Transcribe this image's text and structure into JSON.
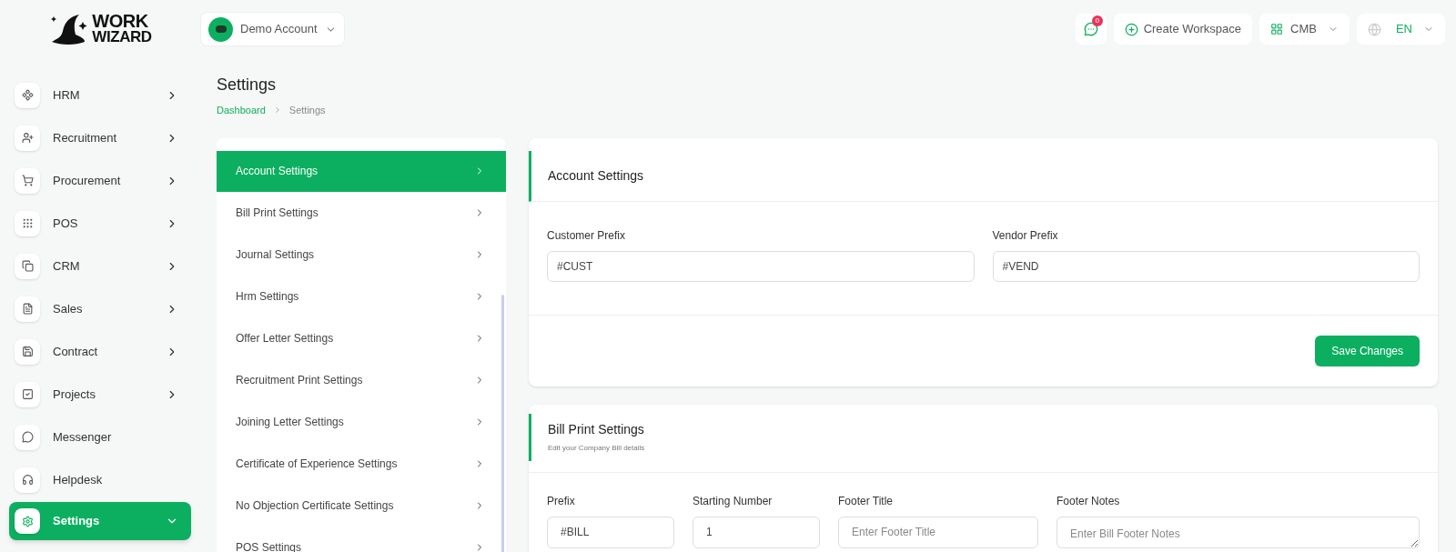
{
  "logo": {
    "line1": "WORK",
    "line2": "WIZARD"
  },
  "account_switcher": {
    "label": "Demo Account"
  },
  "header": {
    "notifications_badge": "0",
    "create_workspace": "Create Workspace",
    "workspace": "CMB",
    "language": "EN"
  },
  "sidebar": {
    "items": [
      {
        "label": "HRM",
        "kind": "submenu",
        "selected": false
      },
      {
        "label": "Recruitment",
        "kind": "submenu",
        "selected": false
      },
      {
        "label": "Procurement",
        "kind": "submenu",
        "selected": false
      },
      {
        "label": "POS",
        "kind": "submenu",
        "selected": false
      },
      {
        "label": "CRM",
        "kind": "submenu",
        "selected": false
      },
      {
        "label": "Sales",
        "kind": "submenu",
        "selected": false
      },
      {
        "label": "Contract",
        "kind": "submenu",
        "selected": false
      },
      {
        "label": "Projects",
        "kind": "submenu",
        "selected": false
      },
      {
        "label": "Messenger",
        "kind": "link",
        "selected": false
      },
      {
        "label": "Helpdesk",
        "kind": "link",
        "selected": false
      },
      {
        "label": "Settings",
        "kind": "submenu",
        "selected": true
      }
    ]
  },
  "page": {
    "title": "Settings",
    "breadcrumb": [
      "Dashboard",
      "Settings"
    ]
  },
  "settings_menu": [
    {
      "label": "Account Settings",
      "selected": true
    },
    {
      "label": "Bill Print Settings",
      "selected": false
    },
    {
      "label": "Journal Settings",
      "selected": false
    },
    {
      "label": "Hrm Settings",
      "selected": false
    },
    {
      "label": "Offer Letter Settings",
      "selected": false
    },
    {
      "label": "Recruitment Print Settings",
      "selected": false
    },
    {
      "label": "Joining Letter Settings",
      "selected": false
    },
    {
      "label": "Certificate of Experience Settings",
      "selected": false
    },
    {
      "label": "No Objection Certificate Settings",
      "selected": false
    },
    {
      "label": "POS Settings",
      "selected": false
    }
  ],
  "account_settings": {
    "title": "Account Settings",
    "fields": [
      {
        "label": "Customer Prefix",
        "value": "#CUST"
      },
      {
        "label": "Vendor Prefix",
        "value": "#VEND"
      }
    ],
    "save_button": "Save Changes"
  },
  "bill_print_settings": {
    "title": "Bill Print Settings",
    "subtitle": "Edit your Company Bill details",
    "fields": [
      {
        "label": "Prefix",
        "value": "#BILL",
        "kind": "input"
      },
      {
        "label": "Starting Number",
        "value": "1",
        "kind": "input"
      },
      {
        "label": "Footer Title",
        "placeholder": "Enter Footer Title",
        "kind": "input"
      },
      {
        "label": "Footer Notes",
        "placeholder": "Enter Bill Footer Notes",
        "kind": "textarea"
      }
    ]
  }
}
